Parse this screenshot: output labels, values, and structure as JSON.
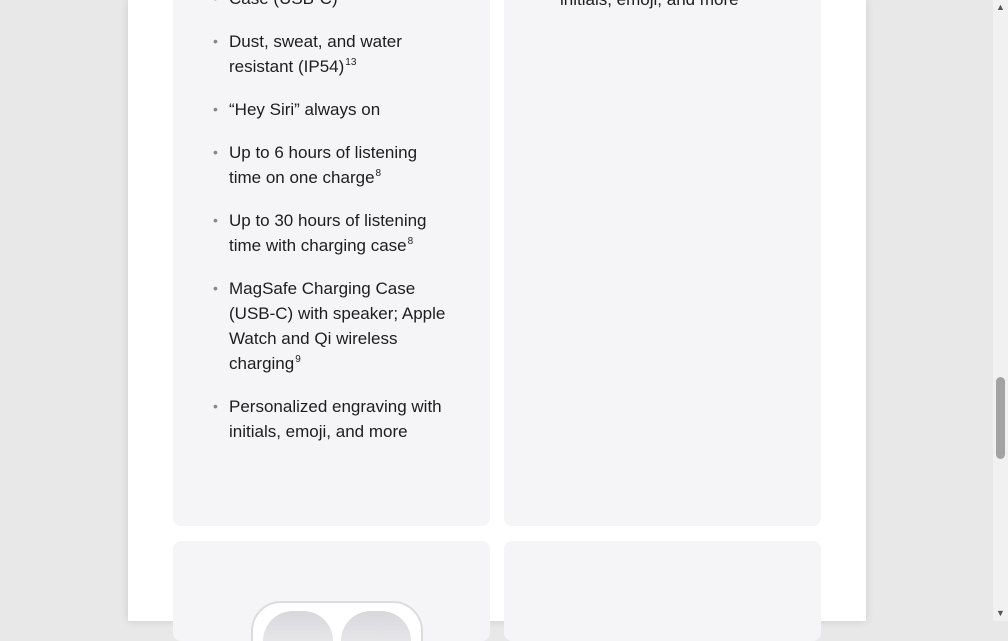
{
  "left_card": {
    "features": [
      {
        "text": "Case (USB-C)",
        "sup": ""
      },
      {
        "text": "Dust, sweat, and water resistant (IP54)",
        "sup": "13"
      },
      {
        "text": "“Hey Siri” always on",
        "sup": ""
      },
      {
        "text": "Up to 6 hours of listening time on one charge",
        "sup": "8"
      },
      {
        "text": "Up to 30 hours of listening time with charging case",
        "sup": "8"
      },
      {
        "text": "MagSafe Charging Case (USB‑C) with speaker; Apple Watch and Qi wireless charging",
        "sup": "9"
      },
      {
        "text": "Personalized engraving with initials, emoji, and more",
        "sup": ""
      }
    ]
  },
  "right_card": {
    "tail_text": "initials, emoji, and more"
  },
  "scrollbar": {
    "up_icon": "triangle-up-icon",
    "down_icon": "triangle-down-icon",
    "position_fraction": 0.61
  }
}
